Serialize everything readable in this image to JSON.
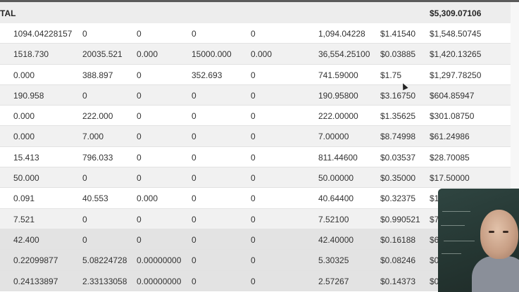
{
  "table": {
    "total": {
      "label": "TAL",
      "value": "$5,309.07106"
    },
    "rows": [
      [
        "1094.04228157",
        "0",
        "0",
        "0",
        "0",
        "1,094.04228",
        "$1.41540",
        "$1,548.50745"
      ],
      [
        "1518.730",
        "20035.521",
        "0.000",
        "15000.000",
        "0.000",
        "36,554.25100",
        "$0.03885",
        "$1,420.13265"
      ],
      [
        "0.000",
        "388.897",
        "0",
        "352.693",
        "0",
        "741.59000",
        "$1.75",
        "$1,297.78250"
      ],
      [
        "190.958",
        "0",
        "0",
        "0",
        "0",
        "190.95800",
        "$3.16750",
        "$604.85947"
      ],
      [
        "0.000",
        "222.000",
        "0",
        "0",
        "0",
        "222.00000",
        "$1.35625",
        "$301.08750"
      ],
      [
        "0.000",
        "7.000",
        "0",
        "0",
        "0",
        "7.00000",
        "$8.74998",
        "$61.24986"
      ],
      [
        "15.413",
        "796.033",
        "0",
        "0",
        "0",
        "811.44600",
        "$0.03537",
        "$28.70085"
      ],
      [
        "50.000",
        "0",
        "0",
        "0",
        "0",
        "50.00000",
        "$0.35000",
        "$17.50000"
      ],
      [
        "0.091",
        "40.553",
        "0.000",
        "0",
        "0",
        "40.64400",
        "$0.32375",
        "$1"
      ],
      [
        "7.521",
        "0",
        "0",
        "0",
        "0",
        "7.52100",
        "$0.990521",
        "$7"
      ],
      [
        "42.400",
        "0",
        "0",
        "0",
        "0",
        "42.40000",
        "$0.16188",
        "$6"
      ],
      [
        "0.22099877",
        "5.08224728",
        "0.00000000",
        "0",
        "0",
        "5.30325",
        "$0.08246",
        "$0"
      ],
      [
        "0.24133897",
        "2.33133058",
        "0.00000000",
        "0",
        "0",
        "2.57267",
        "$0.14373",
        "$0"
      ]
    ]
  },
  "webcam": {
    "present": true
  }
}
